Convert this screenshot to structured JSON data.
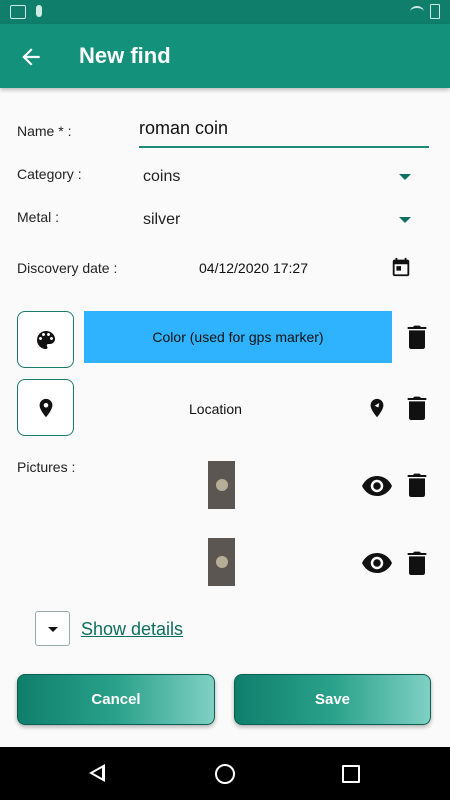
{
  "appbar": {
    "title": "New find"
  },
  "form": {
    "name_label": "Name * :",
    "name_value": "roman coin",
    "category_label": "Category :",
    "category_value": "coins",
    "metal_label": "Metal :",
    "metal_value": "silver",
    "date_label": "Discovery date :",
    "date_value": "04/12/2020 17:27",
    "color_button_label": "Color (used for gps marker)",
    "color_value": "#2fb3ff",
    "location_label": "Location",
    "pictures_label": "Pictures :",
    "show_details": "Show details"
  },
  "actions": {
    "cancel": "Cancel",
    "save": "Save"
  },
  "theme": {
    "primary": "#14917b",
    "primary_dark": "#0f7f6c",
    "link": "#0e6e5f"
  },
  "icons": [
    "back-arrow-icon",
    "calendar-icon",
    "palette-icon",
    "location-pin-icon",
    "trash-icon",
    "eye-icon",
    "location-off-icon",
    "chevron-down-icon"
  ]
}
